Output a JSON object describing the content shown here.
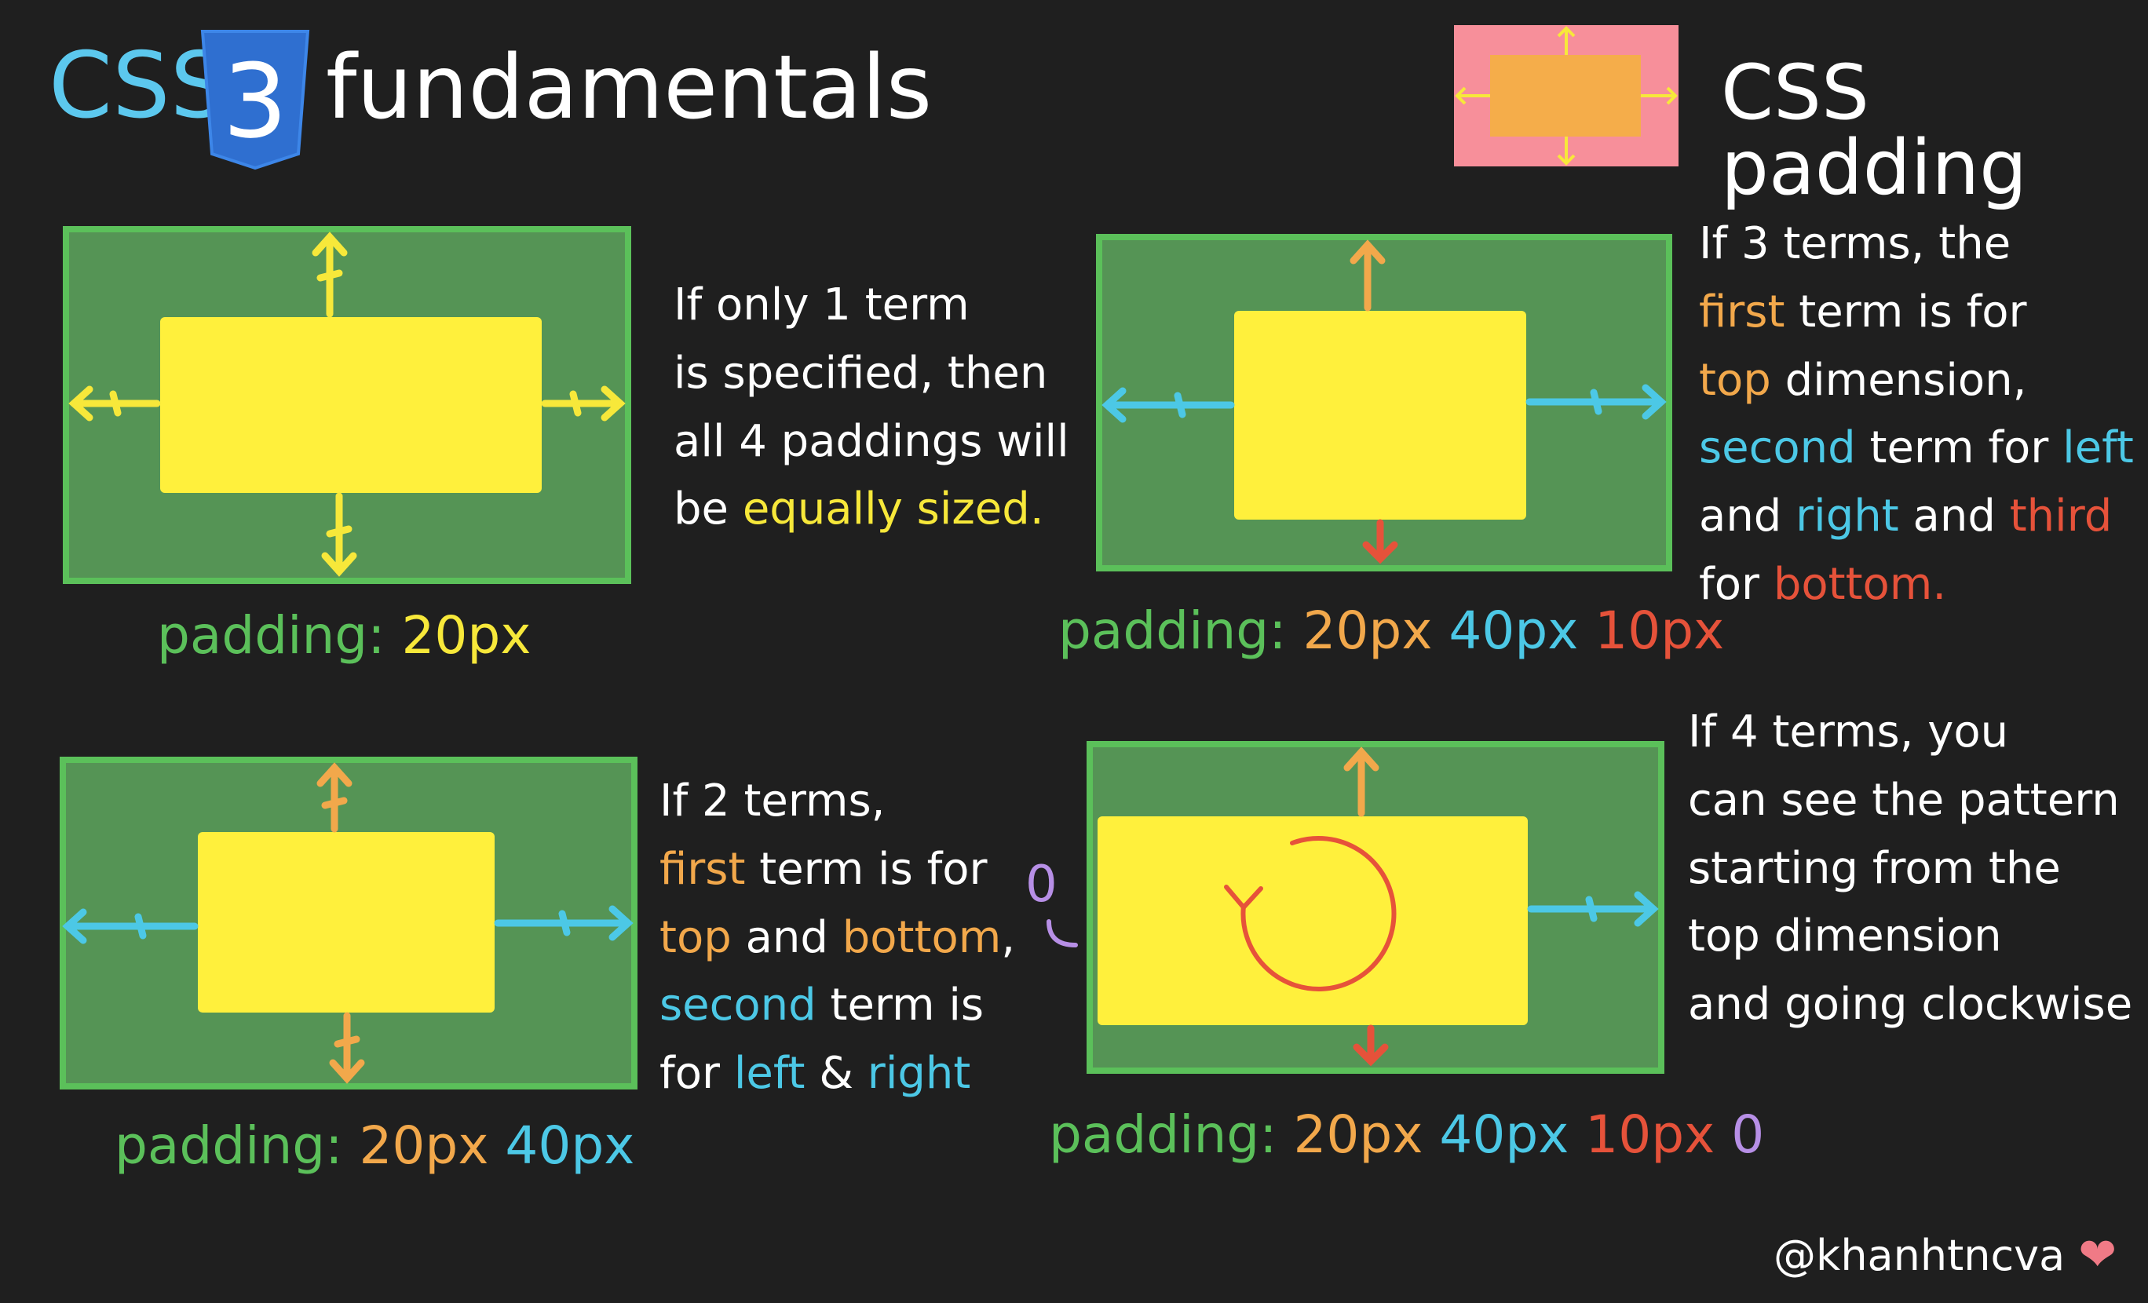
{
  "header": {
    "css_label": "CSS",
    "logo_digit": "3",
    "fundamentals_label": "fundamentals",
    "topic_label": "CSS padding"
  },
  "examples": [
    {
      "caption": {
        "keyword": "padding",
        "colon": ":",
        "values": [
          "20px"
        ]
      },
      "explanation": [
        "If only 1 term",
        "is specified, then",
        "all 4 paddings will",
        [
          "be ",
          "equally sized",
          "."
        ]
      ]
    },
    {
      "caption": {
        "keyword": "padding",
        "colon": ":",
        "values": [
          "20px",
          "40px",
          "10px"
        ]
      },
      "explanation": [
        "If 3 terms, the",
        [
          "first",
          " term is for"
        ],
        [
          "top",
          " dimension,"
        ],
        [
          "second",
          " term for ",
          "left"
        ],
        [
          "and ",
          "right",
          " and ",
          "third"
        ],
        [
          "for ",
          "bottom",
          "."
        ]
      ]
    },
    {
      "caption": {
        "keyword": "padding",
        "colon": ":",
        "values": [
          "20px",
          "40px"
        ]
      },
      "explanation": [
        "If 2 terms,",
        [
          "first",
          " term is for"
        ],
        [
          "top",
          " and ",
          "bottom",
          ","
        ],
        [
          "second",
          " term is"
        ],
        [
          "for ",
          "left",
          " & ",
          "right"
        ]
      ]
    },
    {
      "caption": {
        "keyword": "padding",
        "colon": ":",
        "values": [
          "20px",
          "40px",
          "10px",
          "0"
        ]
      },
      "explanation": [
        "If 4 terms, you",
        "can see the pattern",
        "starting from the",
        "top dimension",
        "and going clockwise"
      ],
      "left_marker": "0"
    }
  ],
  "signature": "@khanhtncva",
  "colors": {
    "background": "#1f1f1f",
    "padding_box": "#559455",
    "padding_border": "#5bc05a",
    "content": "#fff03c",
    "yellow": "#f7e83a",
    "orange": "#f2a84b",
    "blue": "#4cc8e6",
    "red": "#e6523a",
    "purple": "#b78fe6",
    "logo_blue": "#2f6fd0",
    "icon_pink": "#f78f9a",
    "icon_orange": "#f5ad4a"
  }
}
